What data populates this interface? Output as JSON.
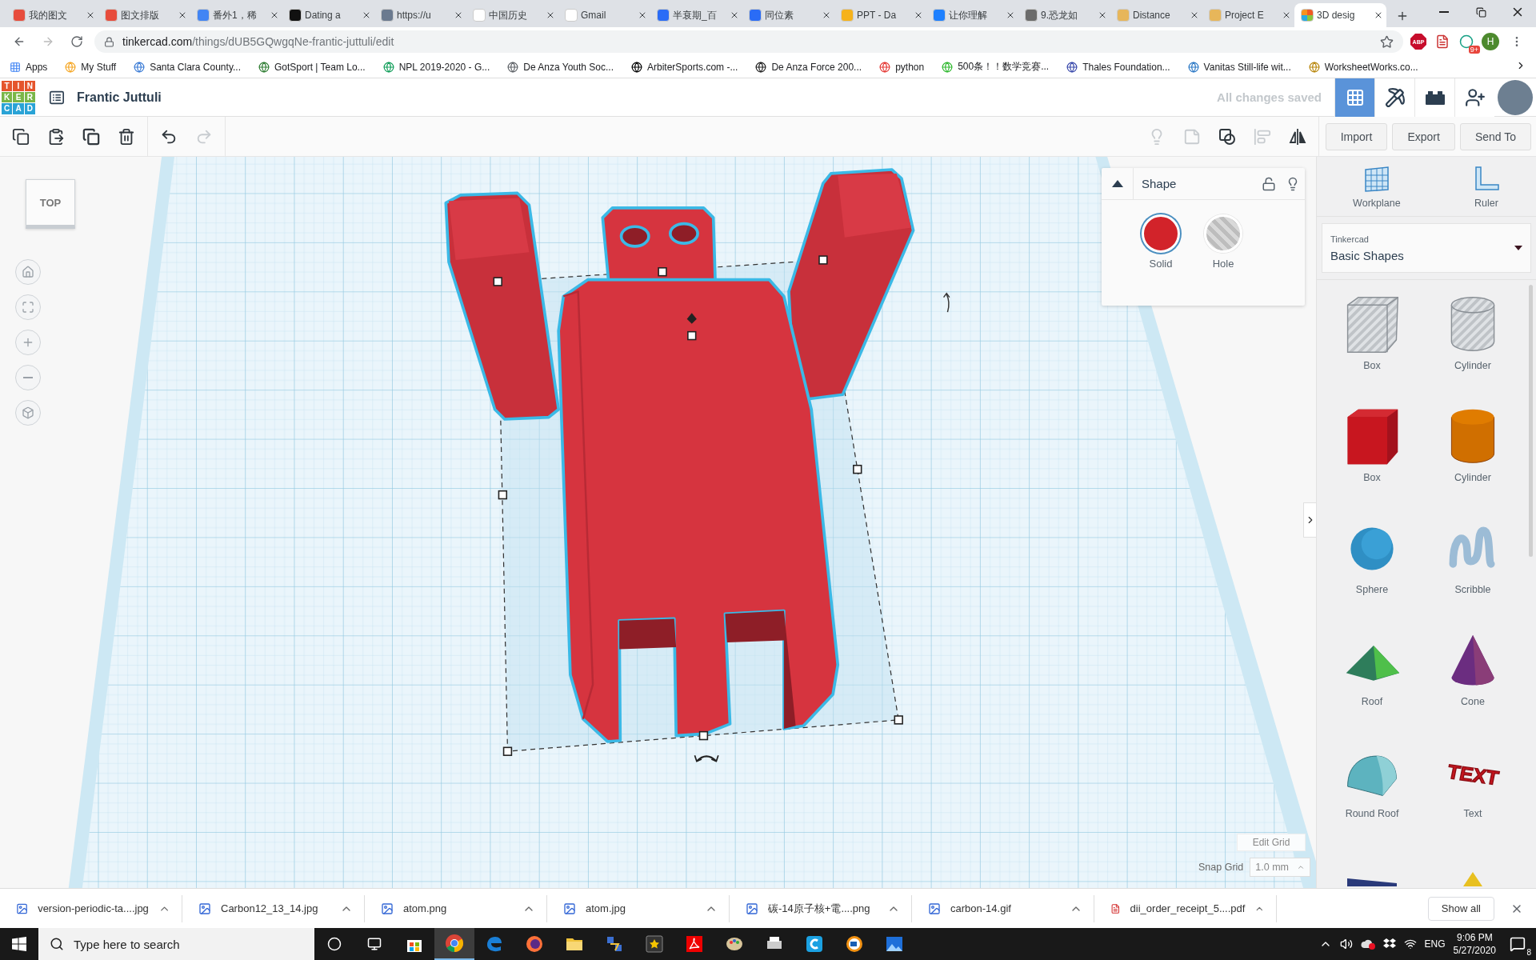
{
  "tabs": [
    {
      "title": "我的图文",
      "selected": false
    },
    {
      "title": "图文排版",
      "selected": false
    },
    {
      "title": "番外1，稀",
      "selected": false
    },
    {
      "title": "Dating a",
      "selected": false
    },
    {
      "title": "https://u",
      "selected": false
    },
    {
      "title": "中国历史",
      "selected": false
    },
    {
      "title": "Gmail",
      "selected": false
    },
    {
      "title": "半衰期_百",
      "selected": false
    },
    {
      "title": "同位素",
      "selected": false
    },
    {
      "title": "PPT - Da",
      "selected": false
    },
    {
      "title": "让你理解",
      "selected": false
    },
    {
      "title": "9.恐龙如",
      "selected": false
    },
    {
      "title": "Distance",
      "selected": false
    },
    {
      "title": "Project E",
      "selected": false
    },
    {
      "title": "3D desig",
      "selected": true
    }
  ],
  "address_bar": {
    "host": "tinkercad.com",
    "path": "/things/dUB5GQwgqNe-frantic-juttuli/edit"
  },
  "extensions": [
    {
      "kind": "abp",
      "label": "ABP"
    },
    {
      "kind": "pdf"
    },
    {
      "kind": "badge",
      "badge": "9+"
    }
  ],
  "profile": {
    "initial": "H"
  },
  "bookmarks": [
    "Apps",
    "My Stuff",
    "Santa Clara County...",
    "GotSport | Team Lo...",
    "NPL 2019-2020 - G...",
    "De Anza Youth Soc...",
    "ArbiterSports.com -...",
    "De Anza Force 200...",
    "python",
    "500条！！数学竞赛...",
    "Thales Foundation...",
    "Vanitas Still-life wit...",
    "WorksheetWorks.co..."
  ],
  "app_header": {
    "logo_letters": [
      "T",
      "I",
      "N",
      "K",
      "E",
      "R",
      "C",
      "A",
      "D"
    ],
    "design_name": "Frantic Juttuli",
    "save_status": "All changes saved",
    "views": [
      {
        "kind": "grid",
        "selected": true
      },
      {
        "kind": "pickaxe",
        "selected": false
      },
      {
        "kind": "bricks",
        "selected": false
      }
    ]
  },
  "toolbar": {
    "left": [
      {
        "kind": "copy",
        "disabled": false
      },
      {
        "kind": "paste",
        "disabled": false
      },
      {
        "kind": "duplicate",
        "disabled": false
      },
      {
        "kind": "delete",
        "disabled": false
      },
      {
        "kind": "undo",
        "disabled": false
      },
      {
        "kind": "redo",
        "disabled": true
      }
    ],
    "right": [
      {
        "kind": "bulb",
        "disabled": true
      },
      {
        "kind": "note",
        "disabled": true
      },
      {
        "kind": "group",
        "disabled": false
      },
      {
        "kind": "align",
        "disabled": true
      },
      {
        "kind": "mirror",
        "disabled": false
      }
    ],
    "buttons": [
      "Import",
      "Export",
      "Send To"
    ]
  },
  "view_cube": {
    "label": "TOP"
  },
  "inspector": {
    "title": "Shape",
    "options": [
      {
        "label": "Solid",
        "kind": "solid",
        "selected": true
      },
      {
        "label": "Hole",
        "kind": "hole",
        "selected": false
      }
    ]
  },
  "grid_controls": {
    "edit_button": "Edit Grid",
    "snap_label": "Snap Grid",
    "snap_value": "1.0 mm"
  },
  "shapes_panel": {
    "tools": [
      {
        "label": "Workplane",
        "kind": "workplane"
      },
      {
        "label": "Ruler",
        "kind": "ruler"
      }
    ],
    "library": {
      "source": "Tinkercad",
      "name": "Basic Shapes"
    },
    "shapes": [
      {
        "label": "Box",
        "kind": "box-hole"
      },
      {
        "label": "Cylinder",
        "kind": "cylinder-hole"
      },
      {
        "label": "Box",
        "kind": "box"
      },
      {
        "label": "Cylinder",
        "kind": "cylinder"
      },
      {
        "label": "Sphere",
        "kind": "sphere"
      },
      {
        "label": "Scribble",
        "kind": "scribble"
      },
      {
        "label": "Roof",
        "kind": "roof"
      },
      {
        "label": "Cone",
        "kind": "cone"
      },
      {
        "label": "Round Roof",
        "kind": "round-roof"
      },
      {
        "label": "Text",
        "kind": "text",
        "icon_text": "TEXT"
      }
    ]
  },
  "downloads": {
    "files": [
      {
        "name": "version-periodic-ta....jpg",
        "kind": "image"
      },
      {
        "name": "Carbon12_13_14.jpg",
        "kind": "image"
      },
      {
        "name": "atom.png",
        "kind": "image"
      },
      {
        "name": "atom.jpg",
        "kind": "image"
      },
      {
        "name": "碳-14原子核+電....png",
        "kind": "image"
      },
      {
        "name": "carbon-14.gif",
        "kind": "image"
      },
      {
        "name": "dii_order_receipt_5....pdf",
        "kind": "pdf"
      }
    ],
    "show_all": "Show all"
  },
  "taskbar": {
    "search_placeholder": "Type here to search",
    "apps": [
      {
        "kind": "store",
        "selected": false
      },
      {
        "kind": "chrome",
        "selected": true
      },
      {
        "kind": "edge",
        "selected": false
      },
      {
        "kind": "firefox",
        "selected": false
      },
      {
        "kind": "folder",
        "selected": false
      },
      {
        "kind": "network",
        "selected": false
      },
      {
        "kind": "star-app",
        "selected": false
      },
      {
        "kind": "pdf",
        "selected": false
      },
      {
        "kind": "paint",
        "selected": false
      },
      {
        "kind": "printer",
        "selected": false
      },
      {
        "kind": "c-app",
        "selected": false
      },
      {
        "kind": "camera",
        "selected": false
      },
      {
        "kind": "photos",
        "selected": false
      }
    ],
    "language": "ENG",
    "time": "9:06 PM",
    "date": "5/27/2020",
    "notifications": "8"
  }
}
